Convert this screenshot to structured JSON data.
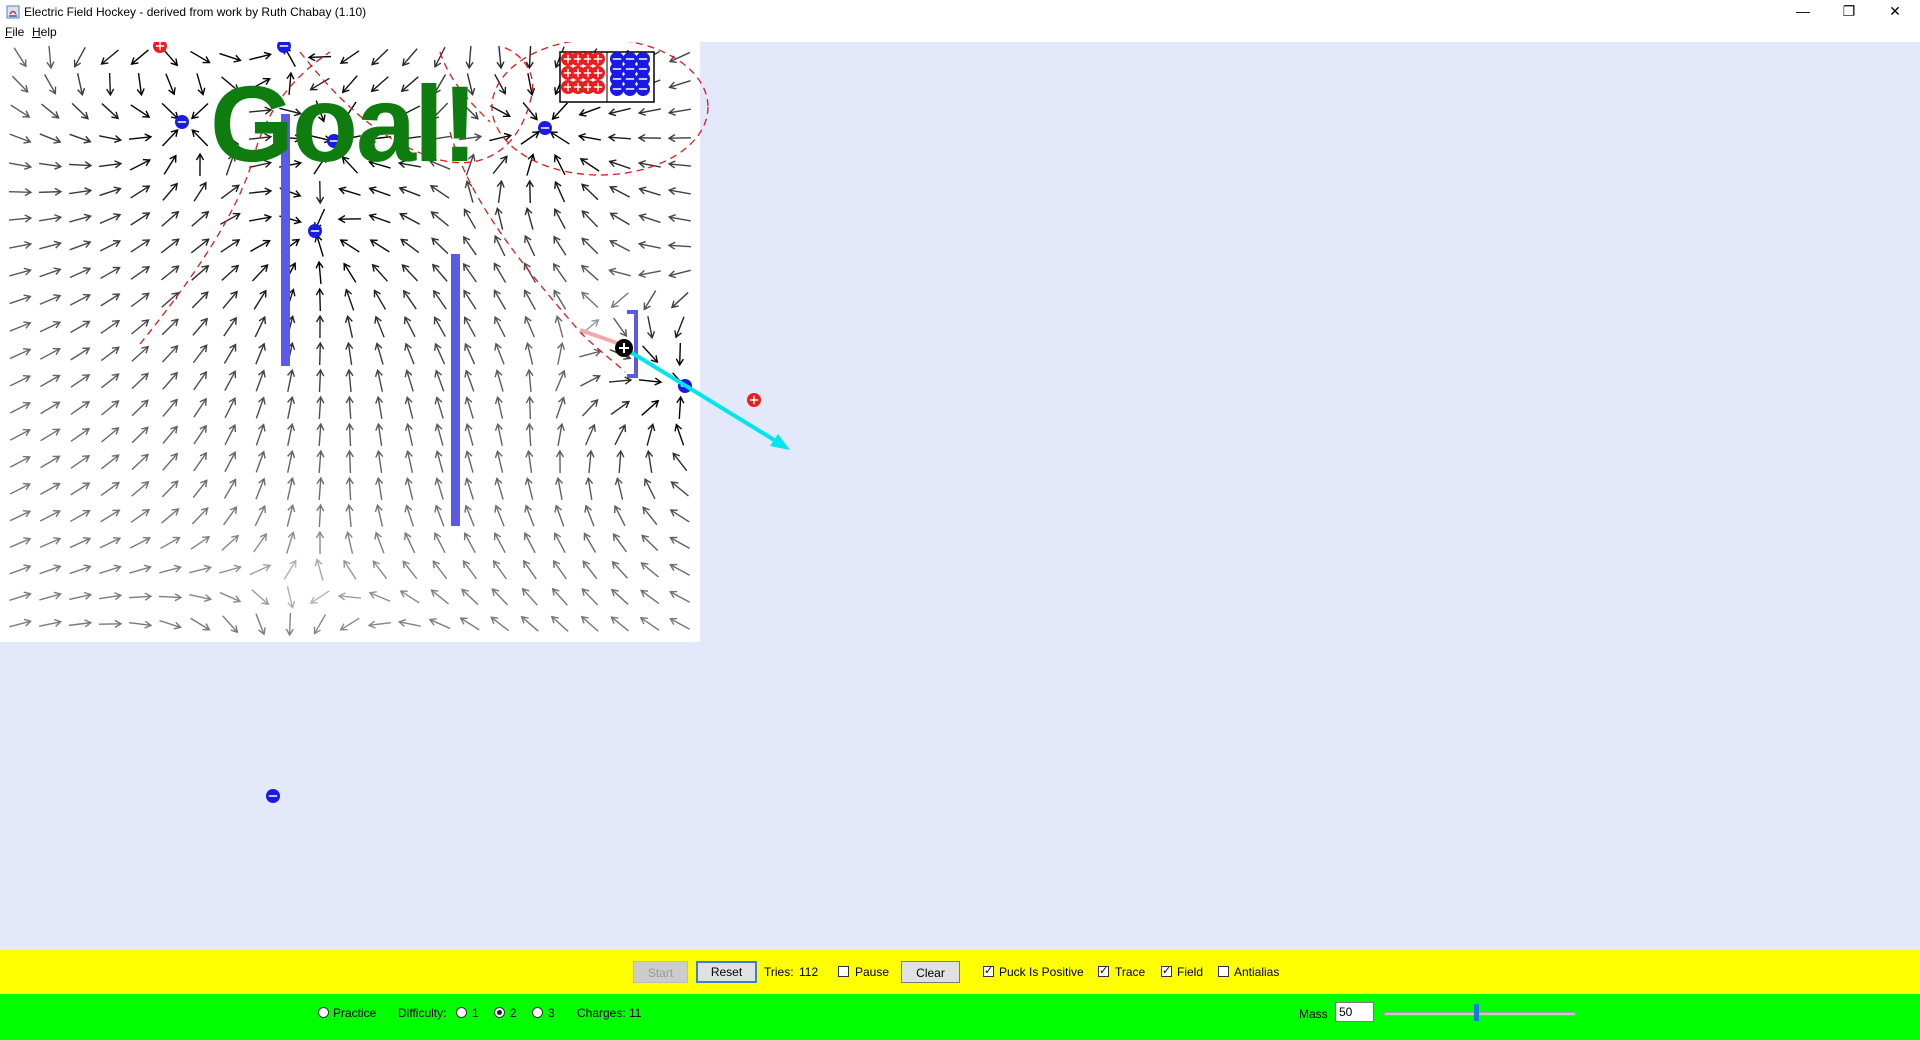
{
  "window": {
    "title": "Electric Field Hockey - derived from work by Ruth Chabay (1.10)",
    "minimize_glyph": "—",
    "maximize_glyph": "❐",
    "close_glyph": "✕"
  },
  "menu": {
    "file": "File",
    "help": "Help"
  },
  "playfield": {
    "message": "Goal!",
    "colors": {
      "background": "#e3e8fb",
      "field_panel": "#ffffff",
      "positive_charge": "#ee1c1c",
      "negative_charge": "#1a1ae6",
      "wall": "#5a5ae6",
      "trace": "#e00000",
      "force_vector": "#00e5ee",
      "goal_text": "#0f7c0f"
    },
    "icons": {
      "positive": "plus-charge-icon",
      "negative": "minus-charge-icon",
      "puck": "puck-icon"
    }
  },
  "controls": {
    "start_label": "Start",
    "reset_label": "Reset",
    "tries_label": "Tries:",
    "tries_value": "112",
    "pause_label": "Pause",
    "pause_checked": false,
    "clear_label": "Clear",
    "puck_positive_label": "Puck Is Positive",
    "puck_positive_checked": true,
    "trace_label": "Trace",
    "trace_checked": true,
    "field_label": "Field",
    "field_checked": true,
    "antialias_label": "Antialias",
    "antialias_checked": false
  },
  "difficulty": {
    "practice_label": "Practice",
    "difficulty_label": "Difficulty:",
    "levels": [
      "1",
      "2",
      "3"
    ],
    "selected_level": "2",
    "charges_label": "Charges: 11",
    "mass_label": "Mass",
    "mass_value": "50"
  },
  "checkmark_glyph": "✓"
}
